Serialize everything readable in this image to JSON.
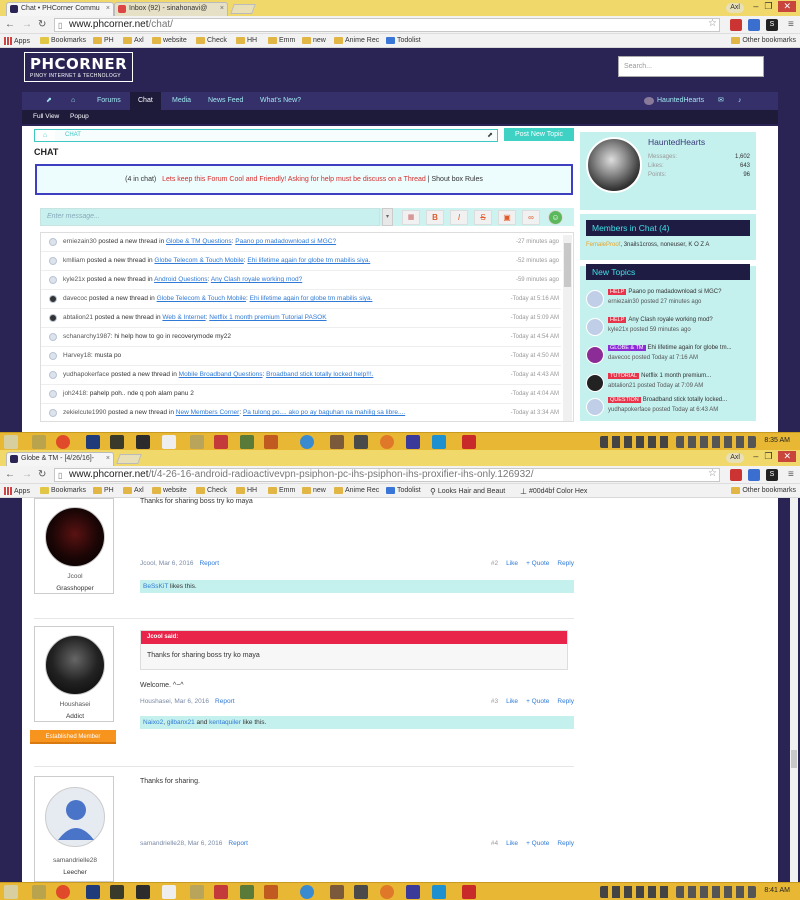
{
  "w1": {
    "tabs": [
      {
        "label": "Chat • PHCorner Commu"
      },
      {
        "label": "Inbox (92) - sinahonavi@"
      }
    ],
    "user": "Axl",
    "url_prefix": "www.phcorner.net",
    "url_path": "/chat/",
    "bookmarks": [
      "Apps",
      "Bookmarks",
      "PH",
      "Axl",
      "website",
      "Check",
      "HH",
      "Emm",
      "new",
      "Anime Rec",
      "Todolist"
    ],
    "other_bookmarks": "Other bookmarks",
    "logo": {
      "big": "PHCORNER",
      "small": "PINOY INTERNET & TECHNOLOGY"
    },
    "search_placeholder": "Search...",
    "nav": {
      "forums": "Forums",
      "chat": "Chat",
      "media": "Media",
      "news": "News Feed",
      "whats_new": "What's New?",
      "user": "HauntedHearts"
    },
    "subnav": {
      "full_view": "Full View",
      "popup": "Popup"
    },
    "crumb": "CHAT",
    "post_new_topic": "Post New Topic",
    "page_title": "CHAT",
    "notice": {
      "count": "(4 in chat)",
      "red": "Lets keep this Forum Cool and Friendly! Asking for help must be discuss on a Thread",
      "sep": " | ",
      "rules": "Shout box Rules"
    },
    "message_placeholder": "Enter message...",
    "format_buttons": [
      "B",
      "I",
      "S"
    ],
    "shouts": [
      {
        "user": "erniezain30",
        "action": " posted a new thread in ",
        "forum": "Globe & TM Questions",
        "sep": ": ",
        "thread": "Paano po madadownload si MGC?",
        "time": "-27 minutes ago",
        "dark": false
      },
      {
        "user": "kmlliam",
        "action": " posted a new thread in ",
        "forum": "Globe Telecom & Touch Mobile",
        "sep": ": ",
        "thread": "Ehi lifetime again for globe tm mabilis siya.",
        "time": "-52 minutes ago",
        "dark": false
      },
      {
        "user": "kyle21x",
        "action": " posted a new thread in ",
        "forum": "Android Questions",
        "sep": ": ",
        "thread": "Any Clash royale working mod?",
        "time": "-59 minutes ago",
        "dark": false
      },
      {
        "user": "davecoc",
        "action": " posted a new thread in ",
        "forum": "Globe Telecom & Touch Mobile",
        "sep": ": ",
        "thread": "Ehi lifetime again for globe tm mabilis siya.",
        "time": "-Today at 5:16 AM",
        "dark": true
      },
      {
        "user": "abtalion21",
        "action": " posted a new thread in ",
        "forum": "Web & Internet",
        "sep": ": ",
        "thread": "Netflix 1 month premium Tutorial PASOK",
        "time": "-Today at 5:09 AM",
        "dark": true
      },
      {
        "user": "schanarchy1987",
        "action": ": hi help how to go in recoverymode my22",
        "forum": "",
        "sep": "",
        "thread": "",
        "time": "-Today at 4:54 AM",
        "dark": false
      },
      {
        "user": "Harvey18",
        "action": ": musta po",
        "forum": "",
        "sep": "",
        "thread": "",
        "time": "-Today at 4:50 AM",
        "dark": false
      },
      {
        "user": "yudhapokerface",
        "action": " posted a new thread in ",
        "forum": "Mobile Broadband Questions",
        "sep": ": ",
        "thread": "Broadband stick totally locked help!!!.",
        "time": "-Today at 4:43 AM",
        "dark": false
      },
      {
        "user": "joh2418",
        "action": ": pahelp poh.. nde q poh alam panu 2",
        "forum": "",
        "sep": "",
        "thread": "",
        "time": "-Today at 4:04 AM",
        "dark": false
      },
      {
        "user": "zekielcute1990",
        "action": " posted a new thread in ",
        "forum": "New Members Corner",
        "sep": ": ",
        "thread": "Pa tulong po.... ako po ay baguhan na mahilig sa libre....",
        "time": "-Today at 3:34 AM",
        "dark": false
      }
    ],
    "profile": {
      "name": "HauntedHearts",
      "stats": [
        {
          "label": "Messages:",
          "value": "1,602"
        },
        {
          "label": "Likes:",
          "value": "643"
        },
        {
          "label": "Points:",
          "value": "96"
        }
      ]
    },
    "members_title": "Members in Chat (4)",
    "members": {
      "first": "FemaleProof",
      "rest": ", 3nails1cross, noneuser, K O Z A"
    },
    "new_topics_title": "New Topics",
    "topics": [
      {
        "tag": "HELP",
        "tag_color": "#e8344a",
        "title": "Paano po madadownload si MGC?",
        "meta": "erniezain30 posted 27 minutes ago",
        "av": ""
      },
      {
        "tag": "HELP",
        "tag_color": "#e8344a",
        "title": "Any Clash royale working mod?",
        "meta": "kyle21x posted 59 minutes ago",
        "av": ""
      },
      {
        "tag": "GLOBE & TM",
        "tag_color": "#8c2cd6",
        "title": "Ehi lifetime again for globe tm...",
        "meta": "davecoc posted Today at 7:16 AM",
        "av": "r"
      },
      {
        "tag": "TUTORIAL",
        "tag_color": "#e8344a",
        "title": "Netflix 1 month premium...",
        "meta": "abtalion21 posted Today at 7:09 AM",
        "av": "d"
      },
      {
        "tag": "QUESTION",
        "tag_color": "#e8344a",
        "title": "Broadband stick totally locked...",
        "meta": "yudhapokerface posted Today at 6:43 AM",
        "av": ""
      }
    ],
    "time": "8:35 AM"
  },
  "w2": {
    "tabs": [
      {
        "label": "Globe & TM - [4/26/16]-"
      }
    ],
    "user": "Axl",
    "url_prefix": "www.phcorner.net",
    "url_path": "/t/4-26-16-android-radioactivevpn-psiphon-pc-ihs-psiphon-ihs-proxifier-ihs-only.126932/",
    "bookmarks": [
      "Apps",
      "Bookmarks",
      "PH",
      "Axl",
      "website",
      "Check",
      "HH",
      "Emm",
      "new",
      "Anime Rec",
      "Todolist",
      "Looks Hair and Beaut",
      "#00d4bf Color Hex"
    ],
    "other_bookmarks": "Other bookmarks",
    "posts": [
      {
        "text_top": "Thanks for sharing boss try ko maya",
        "user": "Jcool",
        "rank": "Grasshopper",
        "date": "Jcool, Mar 6, 2016",
        "report": "Report",
        "num": "#2",
        "like": "Like",
        "quote": "+ Quote",
        "reply": "Reply",
        "likes_name": "BeSsKiT",
        "likes_text": " likes this."
      },
      {
        "quote_head": "Jcool said:",
        "quote_body": "Thanks for sharing boss try ko maya",
        "text": "Welcome. ^~^",
        "user": "Houshasei",
        "rank": "Addict",
        "banner": "Established Member",
        "date": "Houshasei, Mar 6, 2016",
        "report": "Report",
        "num": "#3",
        "like": "Like",
        "quote": "+ Quote",
        "reply": "Reply",
        "likes_a": "Naixo2",
        "likes_sep1": ", ",
        "likes_b": "gilbanx21",
        "likes_sep2": " and ",
        "likes_c": "kentaquiler",
        "likes_text": " like this."
      },
      {
        "text": "Thanks for sharing.",
        "user": "samandrielle28",
        "rank": "Leecher",
        "date": "samandrielle28, Mar 6, 2016",
        "report": "Report",
        "num": "#4",
        "like": "Like",
        "quote": "+ Quote",
        "reply": "Reply"
      }
    ],
    "time": "8:41 AM"
  },
  "colors": {
    "accent": "#3fd1c4",
    "nav": "#2a2454",
    "taskbar": "#e8b733"
  }
}
